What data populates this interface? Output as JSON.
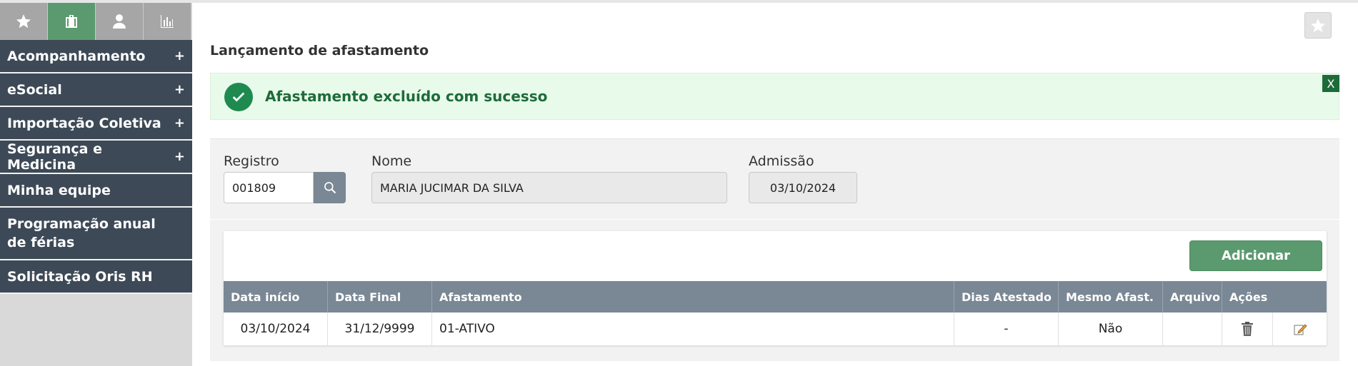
{
  "sidebar": {
    "tabs": [
      {
        "icon": "star-icon"
      },
      {
        "icon": "briefcase-icon"
      },
      {
        "icon": "person-icon"
      },
      {
        "icon": "bar-chart-icon"
      }
    ],
    "items": [
      {
        "label": "Acompanhamento",
        "expand": "+"
      },
      {
        "label": "eSocial",
        "expand": "+"
      },
      {
        "label": "Importação Coletiva",
        "expand": "+"
      },
      {
        "label": "Segurança e Medicina",
        "expand": "+"
      },
      {
        "label": "Minha equipe"
      },
      {
        "label": "Programação anual de férias"
      },
      {
        "label": "Solicitação Oris RH"
      }
    ]
  },
  "header": {
    "title": "Lançamento de afastamento",
    "favorite_icon": "star-icon"
  },
  "alert": {
    "message": "Afastamento excluído com sucesso",
    "close_label": "X",
    "color": "#1e6b3a"
  },
  "form": {
    "registro": {
      "label": "Registro",
      "value": "001809"
    },
    "nome": {
      "label": "Nome",
      "value": "MARIA JUCIMAR DA SILVA"
    },
    "admissao": {
      "label": "Admissão",
      "value": "03/10/2024"
    }
  },
  "table": {
    "add_label": "Adicionar",
    "columns": [
      "Data início",
      "Data Final",
      "Afastamento",
      "Dias Atestado",
      "Mesmo Afast.",
      "Arquivo",
      "Ações"
    ],
    "rows": [
      {
        "data_inicio": "03/10/2024",
        "data_final": "31/12/9999",
        "afastamento": "01-ATIVO",
        "dias_atestado": "-",
        "mesmo_afast": "Não",
        "arquivo": ""
      }
    ]
  },
  "colors": {
    "accent": "#5b9a6f",
    "sidebar": "#3d4956",
    "table_header": "#7a8794"
  }
}
